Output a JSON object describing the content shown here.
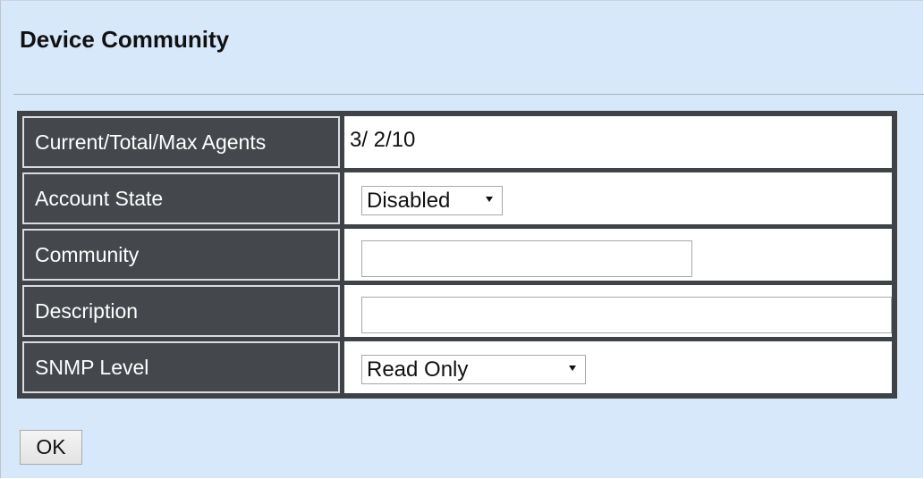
{
  "page": {
    "title": "Device Community"
  },
  "form": {
    "rows": [
      {
        "label": "Current/Total/Max Agents",
        "value": "3/ 2/10"
      },
      {
        "label": "Account State",
        "selected": "Disabled"
      },
      {
        "label": "Community",
        "value": "",
        "placeholder": ""
      },
      {
        "label": "Description",
        "value": "",
        "placeholder": ""
      },
      {
        "label": "SNMP Level",
        "selected": "Read Only"
      }
    ]
  },
  "actions": {
    "ok_label": "OK"
  },
  "colors": {
    "background": "#d7e8fb",
    "label_cell": "#44484c",
    "table_border": "#3f4347",
    "text_on_dark": "#ffffff",
    "text": "#111111"
  },
  "icons": {
    "dropdown": "chevron-down-icon"
  }
}
